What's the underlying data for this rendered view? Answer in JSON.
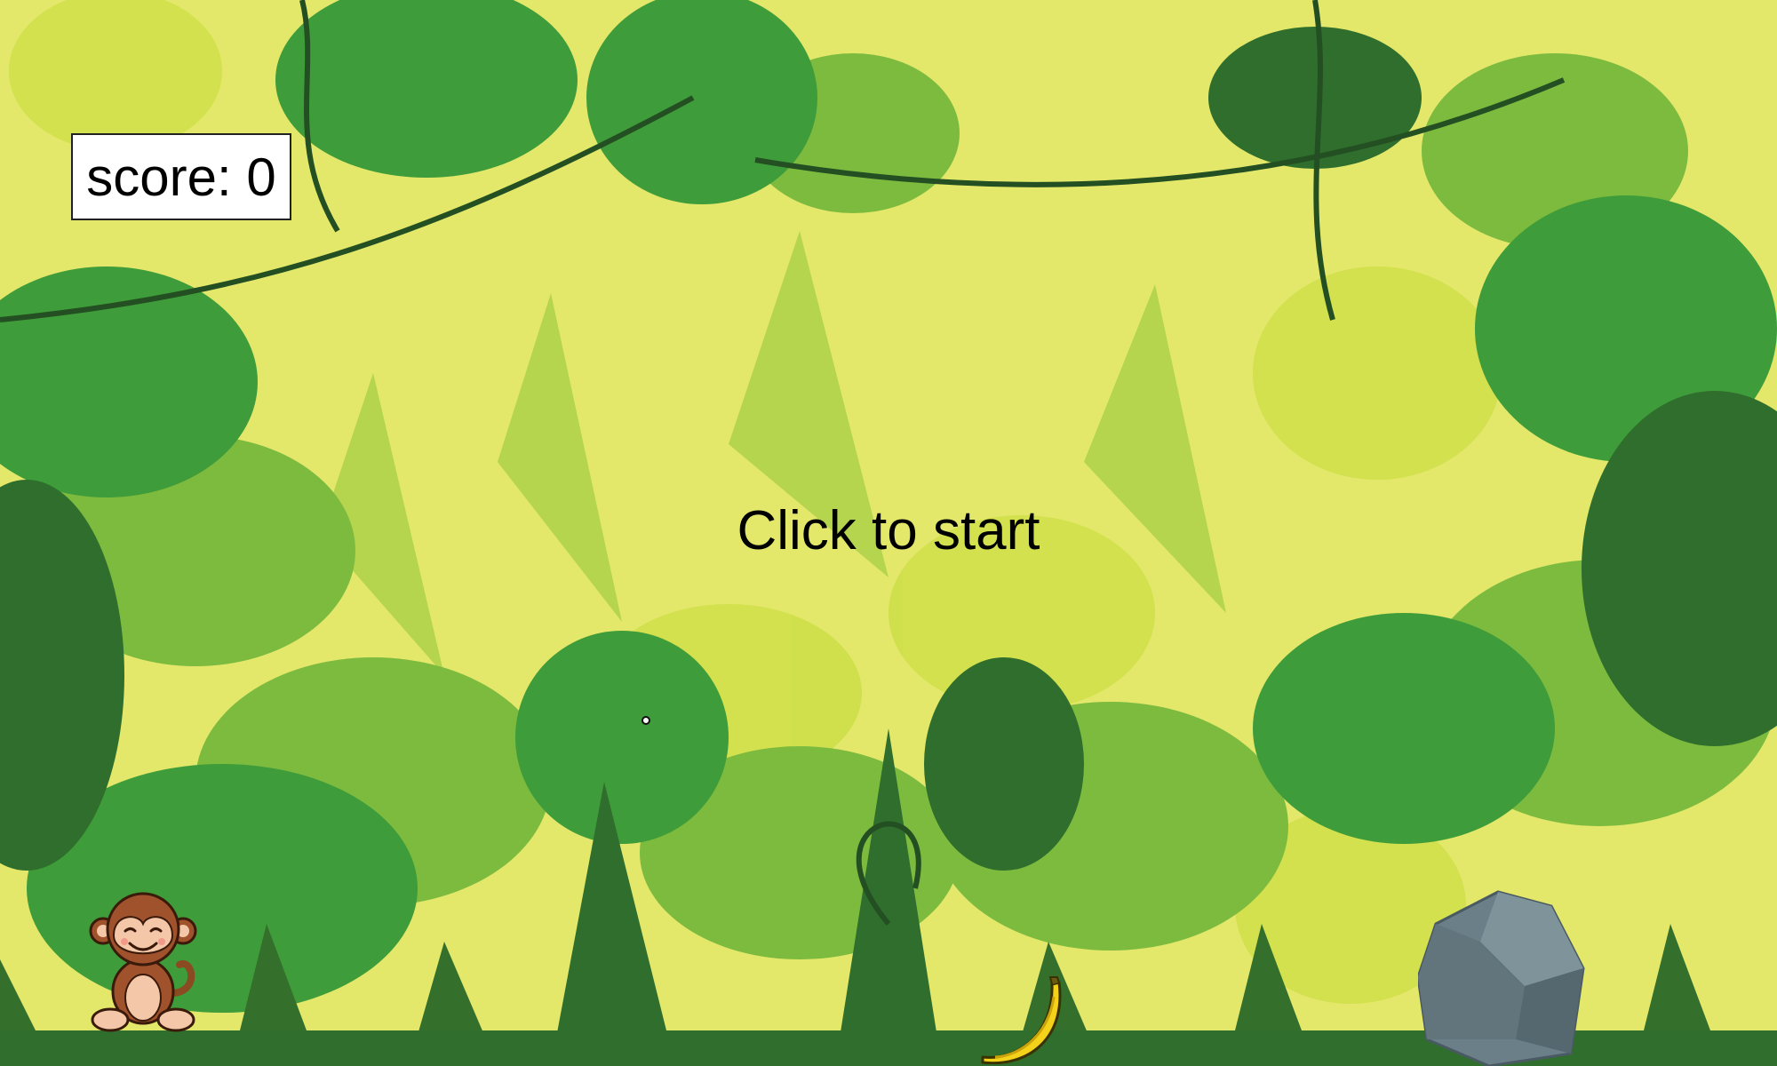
{
  "score": {
    "label": "score: 0",
    "value": 0
  },
  "prompt": {
    "text": "Click to start"
  },
  "sprites": {
    "player": "monkey-icon",
    "collectible": "banana-icon",
    "obstacle": "rock-icon"
  },
  "colors": {
    "sky": "#e3e86a",
    "leaf_light": "#cfe04a",
    "leaf_mid": "#7dbb3f",
    "leaf_green": "#3f9c3a",
    "leaf_dark": "#2f6e2c",
    "rock": "#6b7f88",
    "banana": "#f5d21a",
    "monkey": "#a0522d"
  }
}
